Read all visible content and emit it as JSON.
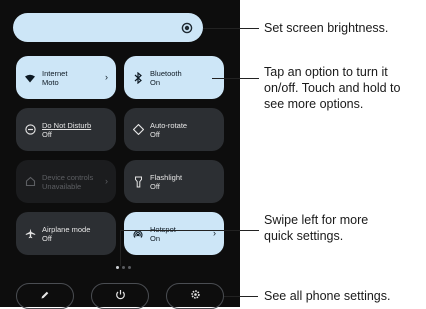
{
  "quick_settings": {
    "tiles": [
      {
        "title": "Internet",
        "subtitle": "Moto",
        "state": "on",
        "icon": "wifi-icon",
        "chevron": "›"
      },
      {
        "title": "Bluetooth",
        "subtitle": "On",
        "state": "on",
        "icon": "bluetooth-icon",
        "chevron": ""
      },
      {
        "title": "Do Not Disturb",
        "subtitle": "Off",
        "state": "off",
        "icon": "do-not-disturb-icon",
        "chevron": ""
      },
      {
        "title": "Auto-rotate",
        "subtitle": "Off",
        "state": "off",
        "icon": "auto-rotate-icon",
        "chevron": ""
      },
      {
        "title": "Device controls",
        "subtitle": "Unavailable",
        "state": "disabled",
        "icon": "home-icon",
        "chevron": "›"
      },
      {
        "title": "Flashlight",
        "subtitle": "Off",
        "state": "off",
        "icon": "flashlight-icon",
        "chevron": ""
      },
      {
        "title": "Airplane mode",
        "subtitle": "Off",
        "state": "off",
        "icon": "airplane-icon",
        "chevron": ""
      },
      {
        "title": "Hotspot",
        "subtitle": "On",
        "state": "on",
        "icon": "hotspot-icon",
        "chevron": "›"
      }
    ],
    "page_indicator": {
      "current": 1,
      "total": 3
    },
    "bottom_buttons": [
      {
        "icon": "edit-pencil-icon",
        "glyph": "✎"
      },
      {
        "icon": "power-icon",
        "glyph": "⏻"
      },
      {
        "icon": "settings-gear-icon",
        "glyph": "⚙"
      }
    ]
  },
  "callouts": {
    "brightness": "Set screen brightness.",
    "tap_line1": "Tap an option to turn it",
    "tap_line2": "on/off. Touch and hold to",
    "tap_line3": "see more options.",
    "swipe_line1": "Swipe left for more",
    "swipe_line2": "quick settings.",
    "settings": "See all phone settings."
  },
  "colors": {
    "tile_on": "#cde6f7",
    "tile_off": "#2c2f33",
    "panel": "#0d0d0d"
  }
}
